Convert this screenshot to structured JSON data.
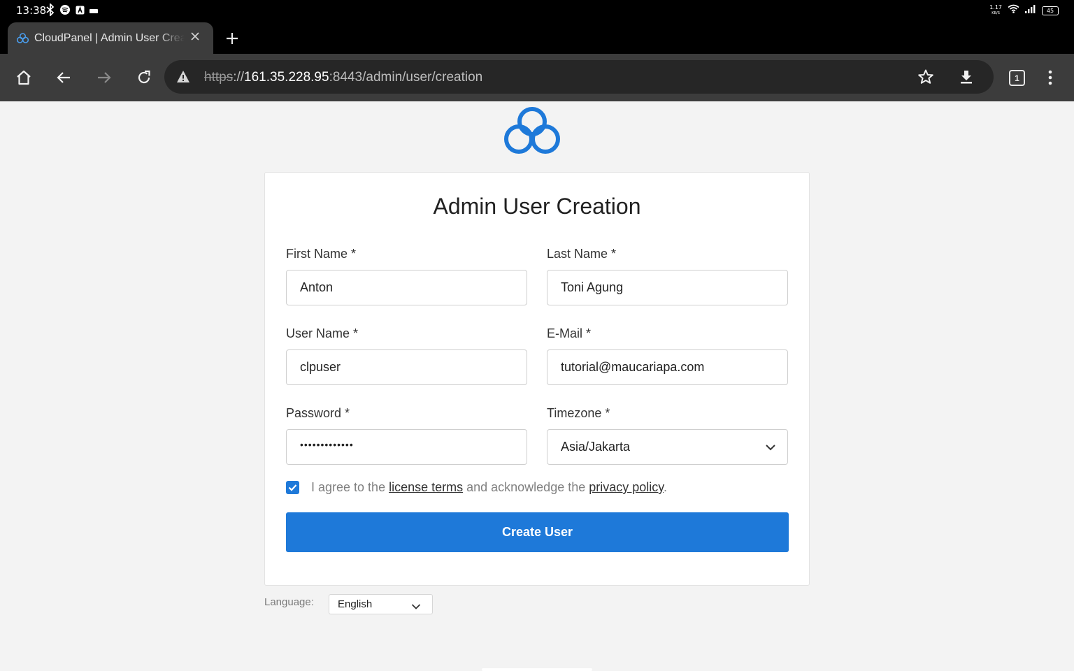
{
  "status_bar": {
    "time": "13:38",
    "net_speed_value": "1.17",
    "net_speed_unit": "KB/S",
    "battery": "45"
  },
  "browser": {
    "tab_title": "CloudPanel | Admin User Creation",
    "url_scheme": "https",
    "url_sep": "://",
    "url_host": "161.35.228.95",
    "url_path": ":8443/admin/user/creation",
    "tab_count": "1"
  },
  "form": {
    "title": "Admin User Creation",
    "first_name": {
      "label": "First Name *",
      "value": "Anton"
    },
    "last_name": {
      "label": "Last Name *",
      "value": "Toni Agung"
    },
    "user_name": {
      "label": "User Name *",
      "value": "clpuser"
    },
    "email": {
      "label": "E-Mail *",
      "value": "tutorial@maucariapa.com"
    },
    "password": {
      "label": "Password *",
      "value": "•••••••••••••"
    },
    "timezone": {
      "label": "Timezone *",
      "value": "Asia/Jakarta"
    },
    "agree": {
      "checked": true,
      "text_before": "I agree to the ",
      "license_link": "license terms",
      "text_middle": " and acknowledge the ",
      "privacy_link": "privacy policy",
      "text_after": "."
    },
    "submit_label": "Create User"
  },
  "language": {
    "label": "Language:",
    "value": "English"
  },
  "colors": {
    "accent": "#1e79d9",
    "background": "#f3f3f3",
    "browser_chrome": "#3c3c3c"
  }
}
